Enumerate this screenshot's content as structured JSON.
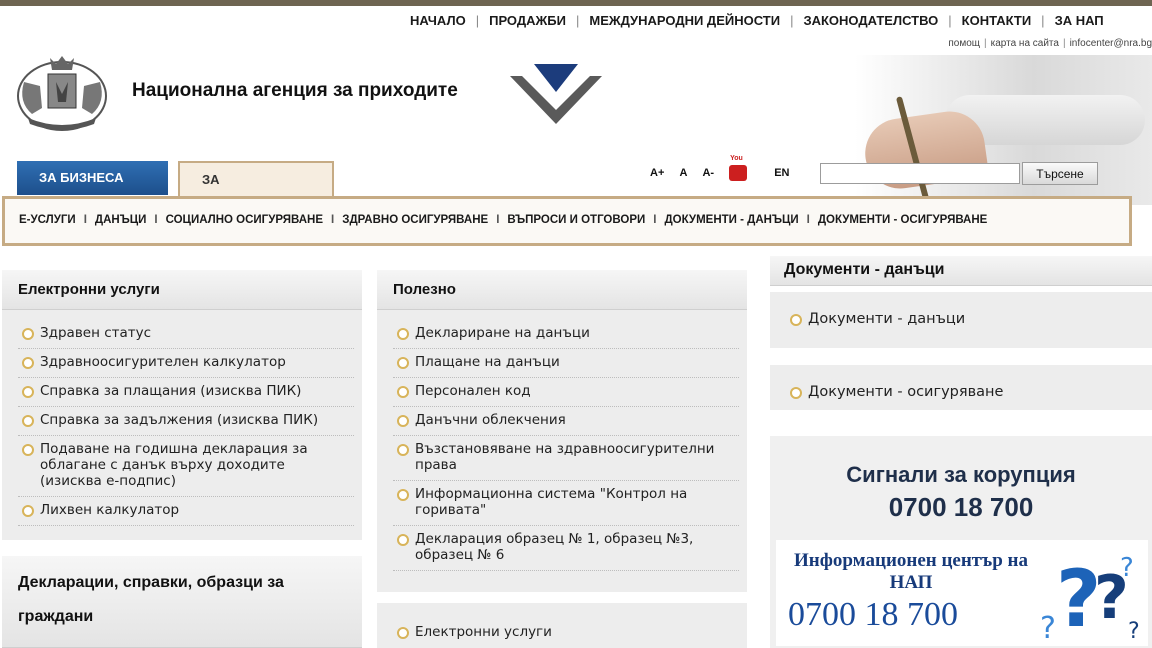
{
  "top_nav": {
    "items": [
      "НАЧАЛО",
      "ПРОДАЖБИ",
      "МЕЖДУНАРОДНИ ДЕЙНОСТИ",
      "ЗАКОНОДАТЕЛСТВО",
      "КОНТАКТИ",
      "ЗА НАП"
    ],
    "separator": "|"
  },
  "sub_nav": {
    "help": "помощ",
    "sitemap": "карта на сайта",
    "email": "infocenter@nra.bg",
    "separator": "|"
  },
  "header": {
    "agency_name": "Национална агенция за приходите"
  },
  "tabs": {
    "business": "ЗА БИЗНЕСА",
    "citizens": "ЗА ГРАЖДАНИТЕ"
  },
  "tools": {
    "font_plus": "A+",
    "font_normal": "A",
    "font_minus": "A-",
    "youtube": "You",
    "lang": "EN"
  },
  "search": {
    "value": "",
    "button": "Търсене"
  },
  "menu": {
    "items": [
      "Е-УСЛУГИ",
      "ДАНЪЦИ",
      "СОЦИАЛНО ОСИГУРЯВАНЕ",
      "ЗДРАВНО ОСИГУРЯВАНЕ",
      "ВЪПРОСИ И ОТГОВОРИ",
      "ДОКУМЕНТИ - ДАНЪЦИ",
      "ДОКУМЕНТИ - ОСИГУРЯВАНЕ"
    ],
    "separator": "I"
  },
  "eservices": {
    "title": "Електронни услуги",
    "items": [
      "Здравен статус",
      "Здравноосигурителен калкулатор",
      "Справка за плащания (изисква ПИК)",
      "Справка за задължения (изисква ПИК)",
      "Подаване на годишна декларация за облагане с данък върху доходите (изисква е-подпис)",
      "Лихвен калкулатор"
    ]
  },
  "declarations": {
    "title": "Декларации, справки, образци за граждани"
  },
  "useful": {
    "title": "Полезно",
    "items": [
      "Деклариране на данъци",
      "Плащане на данъци",
      "Персонален код",
      "Данъчни облекчения",
      "Възстановяване на здравноосигурителни права",
      "Информационна система \"Контрол на горивата\"",
      "Декларация образец № 1, образец №3, образец № 6"
    ]
  },
  "useful2": {
    "items": [
      "Електронни услуги"
    ]
  },
  "docs": {
    "title": "Документи - данъци",
    "item_taxes": "Документи - данъци",
    "item_insurance": "Документи - осигуряване"
  },
  "promo": {
    "corruption_title": "Сигнали за корупция",
    "corruption_phone": "0700 18 700",
    "info_title": "Информационен център на НАП",
    "info_phone": "0700 18 700"
  },
  "colors": {
    "business_tab": "#2f6fb4",
    "citizens_border": "#c6ab84",
    "bullet": "#d8b45a",
    "promo_text": "#1a4b9a"
  }
}
